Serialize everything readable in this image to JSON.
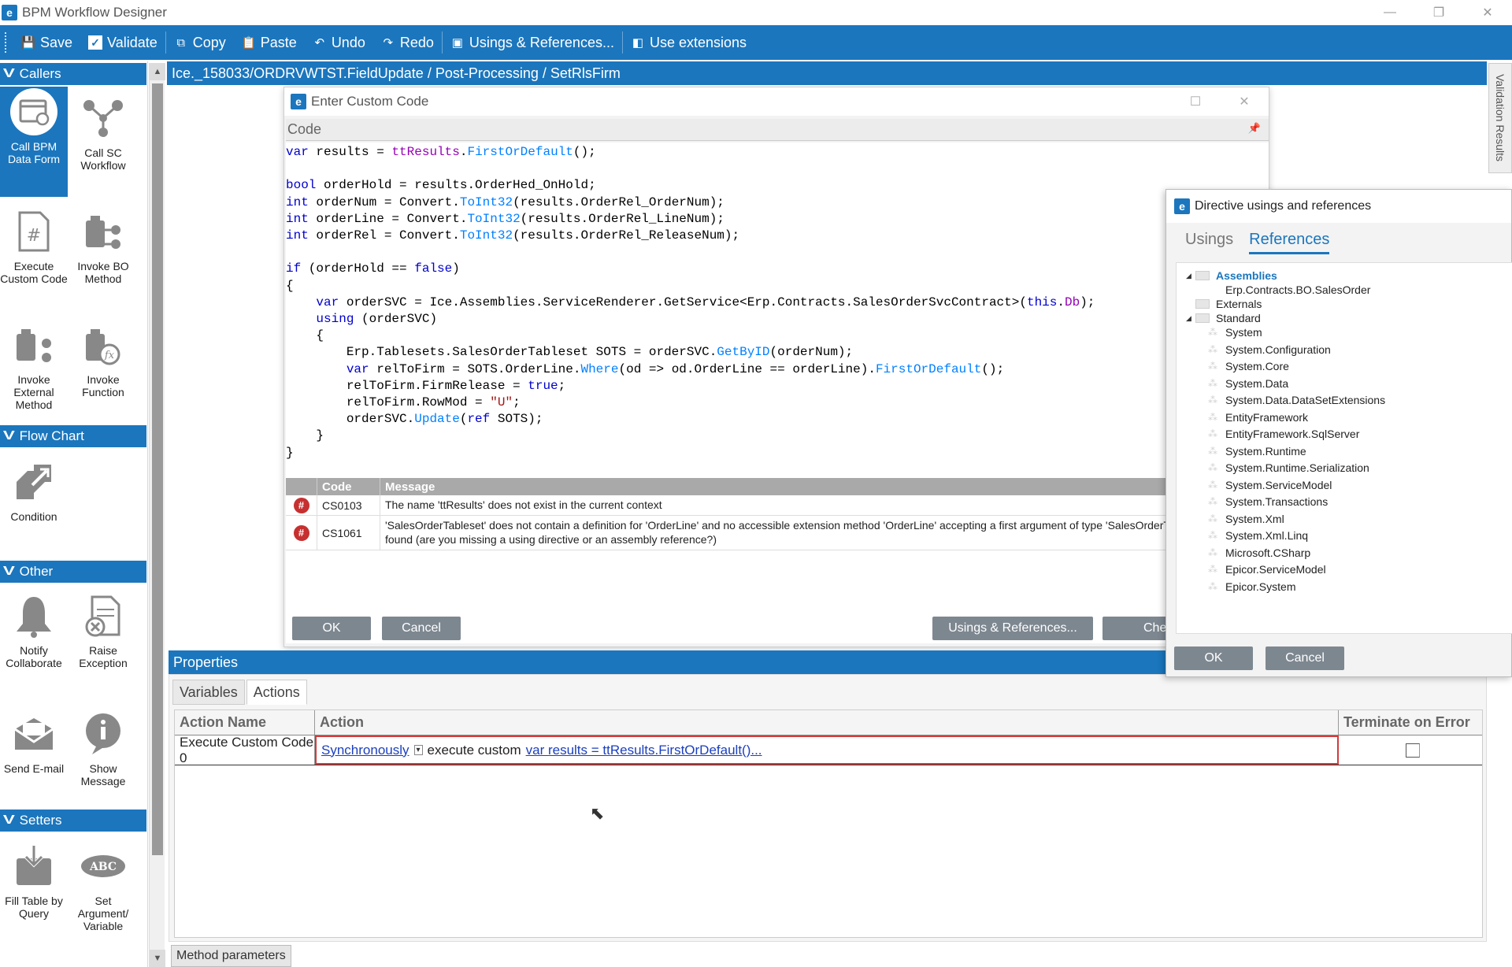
{
  "window": {
    "title": "BPM Workflow Designer",
    "min": "—",
    "restore": "❐",
    "close": "✕"
  },
  "toolbar": {
    "save": "Save",
    "validate": "Validate",
    "copy": "Copy",
    "paste": "Paste",
    "undo": "Undo",
    "redo": "Redo",
    "usings": "Usings & References...",
    "extensions": "Use extensions"
  },
  "breadcrumb": "Ice._158033/ORDRVWTST.FieldUpdate / Post-Processing / SetRlsFirm",
  "validation_tab": "Validation Results",
  "palette": {
    "callers": {
      "label": "Callers",
      "items": [
        "Call BPM Data Form",
        "Call SC Workflow",
        "Execute Custom Code",
        "Invoke BO Method",
        "Invoke External Method",
        "Invoke Function"
      ]
    },
    "flowchart": {
      "label": "Flow Chart",
      "items": [
        "Condition"
      ]
    },
    "other": {
      "label": "Other",
      "items": [
        "Notify Collaborate",
        "Raise Exception",
        "Send E-mail",
        "Show Message"
      ]
    },
    "setters": {
      "label": "Setters",
      "items": [
        "Fill Table by Query",
        "Set Argument/ Variable"
      ]
    }
  },
  "code_dialog": {
    "title": "Enter Custom Code",
    "code_header": "Code",
    "errors": {
      "headers": [
        "Code",
        "Message"
      ],
      "rows": [
        {
          "code": "CS0103",
          "message": "The name 'ttResults' does not exist in the current context"
        },
        {
          "code": "CS1061",
          "message": "'SalesOrderTableset' does not contain a definition for 'OrderLine' and no accessible extension method 'OrderLine' accepting a first argument of type 'SalesOrderTableset' could be found (are you missing a using directive or an assembly reference?)"
        }
      ]
    },
    "ok": "OK",
    "cancel": "Cancel",
    "usings": "Usings & References...",
    "check": "Che"
  },
  "properties": {
    "title": "Properties",
    "tabs": [
      "Variables",
      "Actions"
    ],
    "columns": [
      "Action Name",
      "Action",
      "Terminate on Error"
    ],
    "row": {
      "name": "Execute Custom Code 0",
      "mode": "Synchronously",
      "text": "execute custom",
      "code_link": "var results = ttResults.FirstOrDefault()..."
    },
    "method_tab": "Method parameters"
  },
  "ref_dialog": {
    "title": "Directive usings and references",
    "tabs": [
      "Usings",
      "References"
    ],
    "tree": {
      "assemblies": "Assemblies",
      "assembly_items": [
        "Erp.Contracts.BO.SalesOrder"
      ],
      "externals": "Externals",
      "standard": "Standard",
      "standard_items": [
        "System",
        "System.Configuration",
        "System.Core",
        "System.Data",
        "System.Data.DataSetExtensions",
        "EntityFramework",
        "EntityFramework.SqlServer",
        "System.Runtime",
        "System.Runtime.Serialization",
        "System.ServiceModel",
        "System.Transactions",
        "System.Xml",
        "System.Xml.Linq",
        "Microsoft.CSharp",
        "Epicor.ServiceModel",
        "Epicor.System"
      ]
    },
    "ok": "OK",
    "cancel": "Cancel"
  },
  "colors": {
    "accent": "#1b76bd",
    "error": "#c63030",
    "link": "#1b3fbf"
  }
}
